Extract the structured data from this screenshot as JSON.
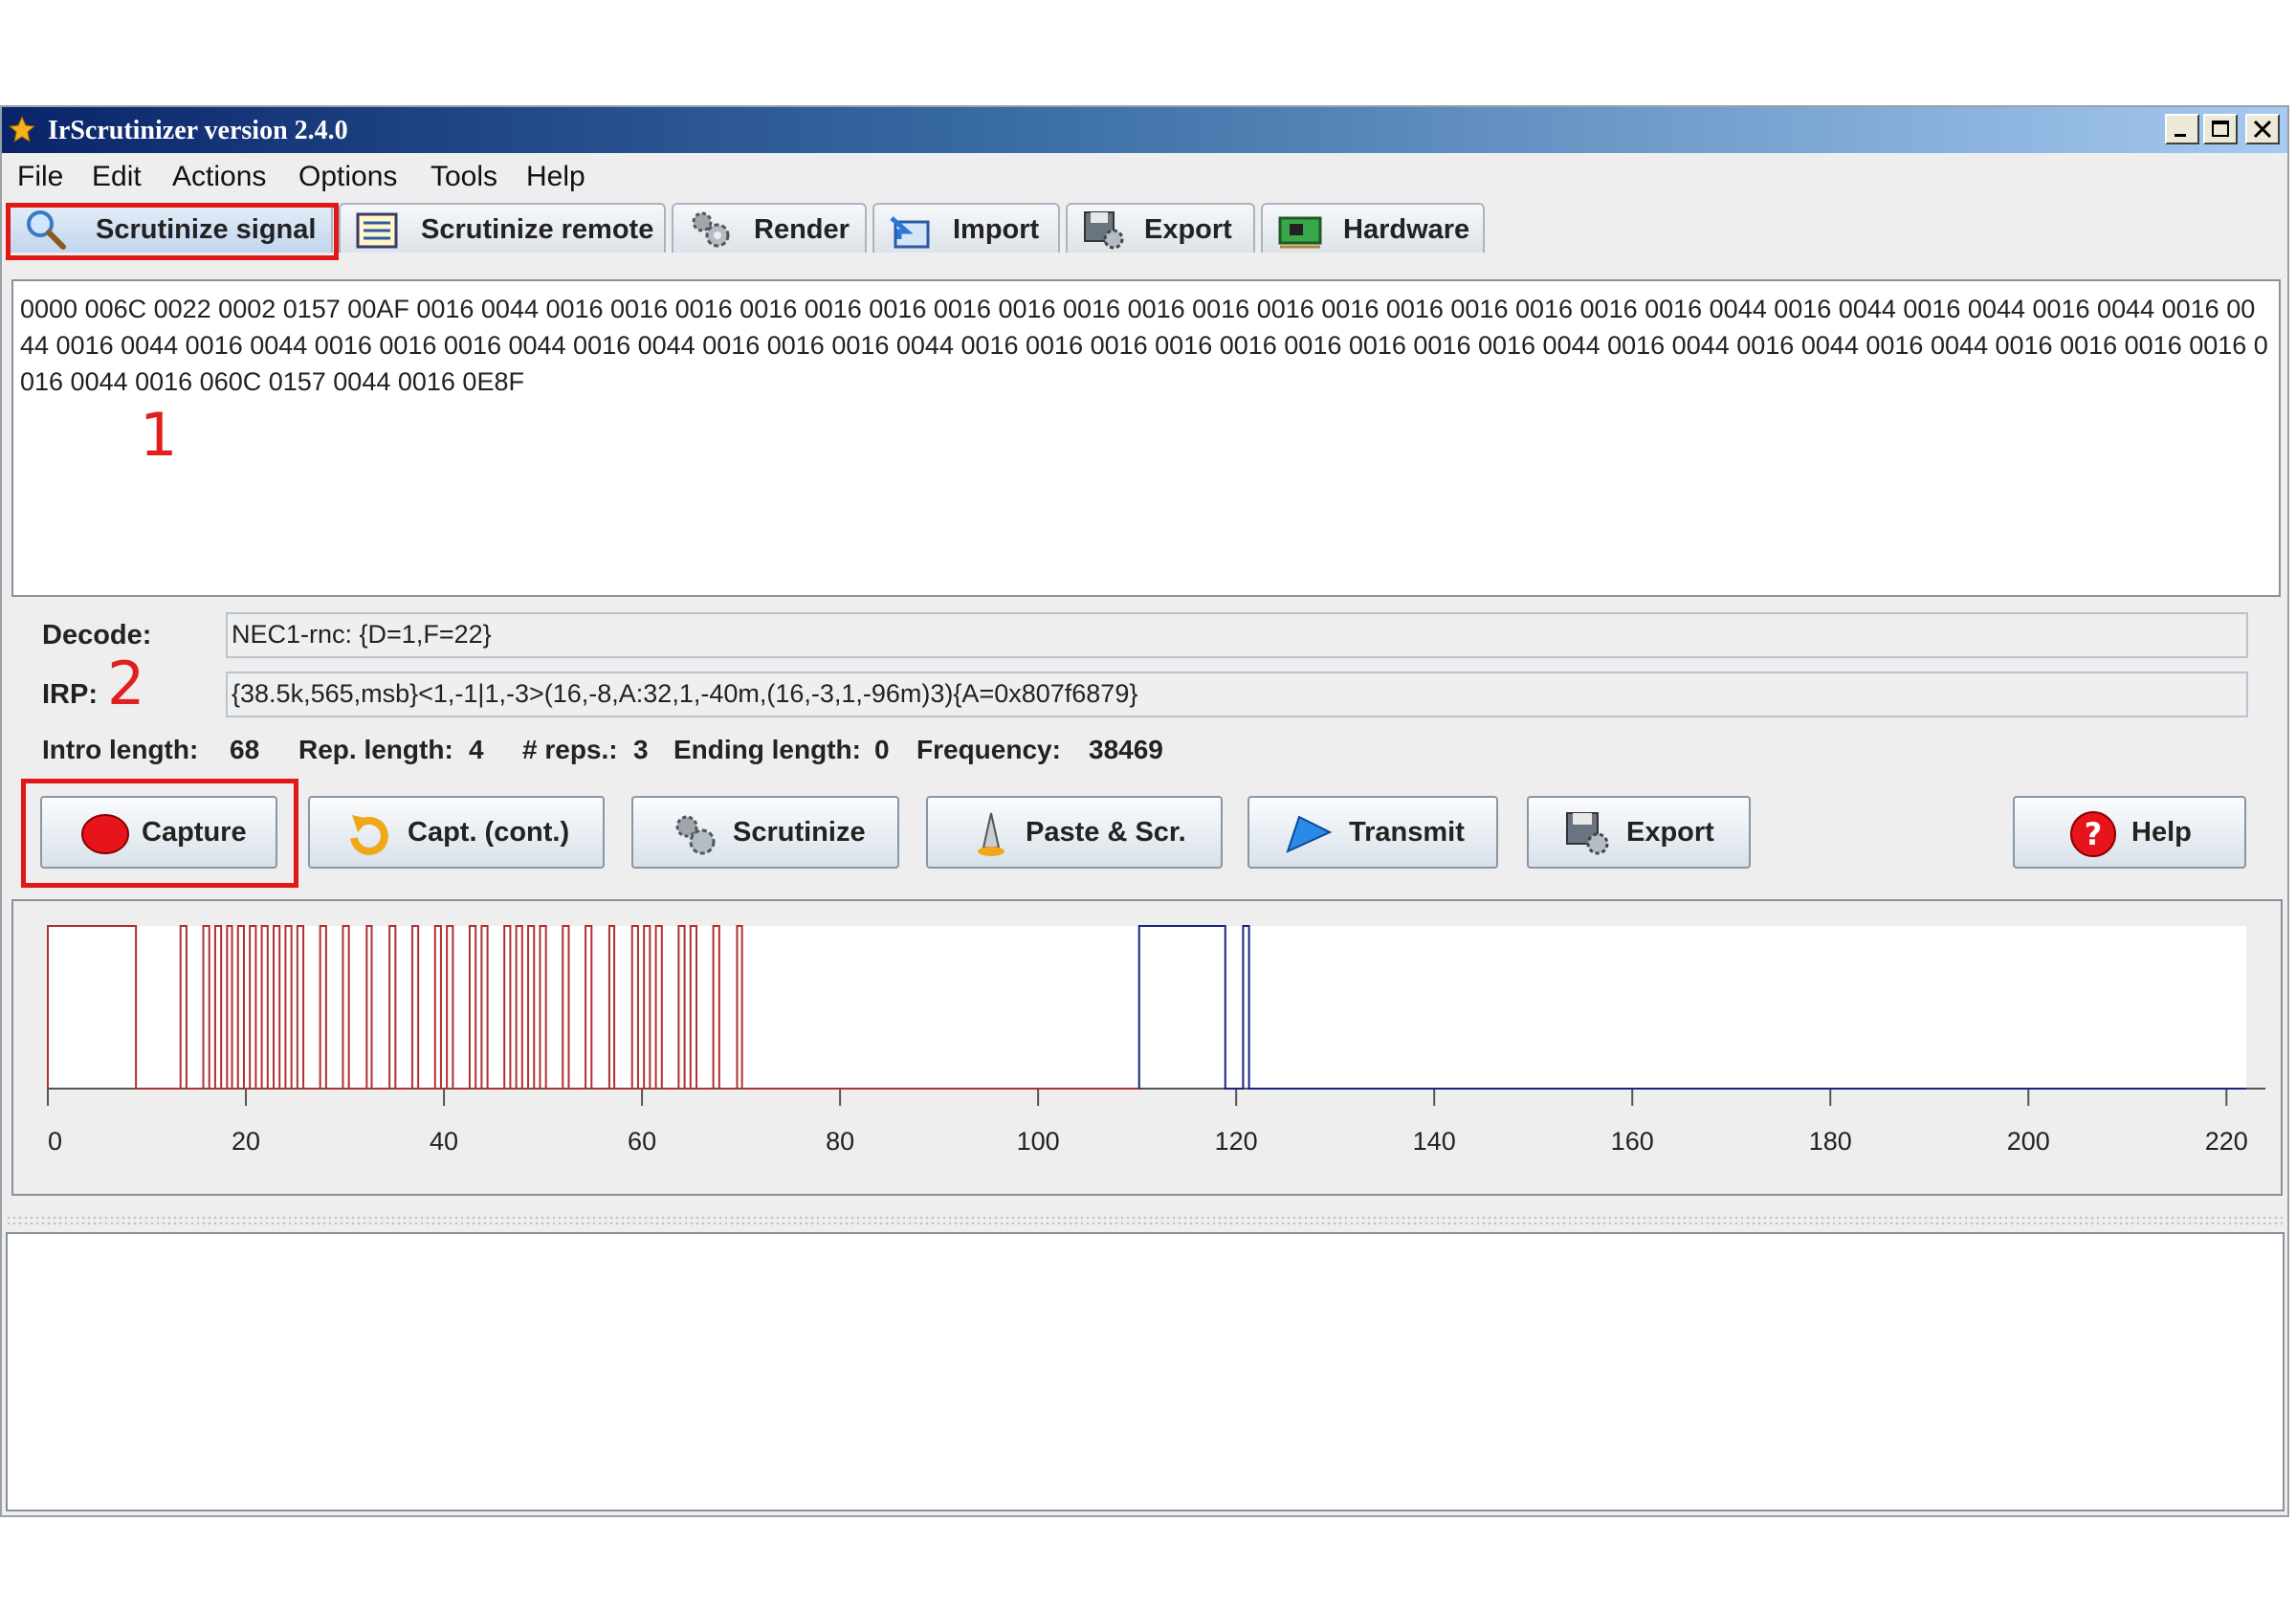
{
  "window": {
    "title": "IrScrutinizer version 2.4.0"
  },
  "menu": [
    "File",
    "Edit",
    "Actions",
    "Options",
    "Tools",
    "Help"
  ],
  "tabs": [
    {
      "label": "Scrutinize signal",
      "icon": "magnifier-icon",
      "active": true
    },
    {
      "label": "Scrutinize remote",
      "icon": "list-icon"
    },
    {
      "label": "Render",
      "icon": "gears-icon"
    },
    {
      "label": "Import",
      "icon": "import-icon"
    },
    {
      "label": "Export",
      "icon": "floppy-gear-icon"
    },
    {
      "label": "Hardware",
      "icon": "hardware-board-icon"
    }
  ],
  "signal": {
    "text": "0000 006C 0022 0002 0157 00AF 0016 0044 0016 0016 0016 0016 0016 0016 0016 0016 0016 0016 0016 0016 0016 0016 0016 0016 0016 0016 0044 0016 0044 0016 0044 0016 0044 0016 0044 0016 0044 0016 0044 0016 0016 0016 0044 0016 0044 0016 0016 0016 0044 0016 0016 0016 0016 0016 0016 0016 0016 0016 0044 0016 0044 0016 0044 0016 0044 0016 0016 0016 0016 0016 0044 0016 060C 0157 0044 0016 0E8F"
  },
  "annotations": {
    "one": "1",
    "two": "2"
  },
  "decode": {
    "label": "Decode:",
    "value": "NEC1-rnc: {D=1,F=22}"
  },
  "irp": {
    "label": "IRP:",
    "value": "{38.5k,565,msb}<1,-1|1,-3>(16,-8,A:32,1,-40m,(16,-3,1,-96m)3){A=0x807f6879}"
  },
  "stats": {
    "intro_label": "Intro length:",
    "intro_value": "68",
    "rep_label": "Rep. length:",
    "rep_value": "4",
    "reps_label": "# reps.:",
    "reps_value": "3",
    "ending_label": "Ending length:",
    "ending_value": "0",
    "freq_label": "Frequency:",
    "freq_value": "38469"
  },
  "buttons": {
    "capture": "Capture",
    "capture_cont": "Capt. (cont.)",
    "scrutinize": "Scrutinize",
    "paste": "Paste & Scr.",
    "transmit": "Transmit",
    "export": "Export",
    "help": "Help"
  },
  "colors": {
    "intro": "#b03030",
    "repeat": "#1a237e",
    "highlight": "#e01818"
  },
  "chart_data": {
    "type": "line",
    "title": "",
    "xlabel": "",
    "ylabel": "",
    "xlim": [
      0,
      222
    ],
    "x_ticks": [
      0,
      20,
      40,
      60,
      80,
      100,
      120,
      140,
      160,
      180,
      200,
      220
    ],
    "grid": false,
    "series": [
      {
        "color": "#b03030",
        "pulses": [
          [
            0,
            8.9
          ],
          [
            13.4,
            14.0
          ],
          [
            15.7,
            16.3
          ],
          [
            16.9,
            17.5
          ],
          [
            18.1,
            18.6
          ],
          [
            19.2,
            19.8
          ],
          [
            20.4,
            21.0
          ],
          [
            21.6,
            22.2
          ],
          [
            22.8,
            23.4
          ],
          [
            24.0,
            24.6
          ],
          [
            25.2,
            25.8
          ],
          [
            27.5,
            28.1
          ],
          [
            29.8,
            30.4
          ],
          [
            32.2,
            32.7
          ],
          [
            34.5,
            35.1
          ],
          [
            36.8,
            37.4
          ],
          [
            39.1,
            39.7
          ],
          [
            40.3,
            40.9
          ],
          [
            42.6,
            43.2
          ],
          [
            43.8,
            44.4
          ],
          [
            46.1,
            46.7
          ],
          [
            47.3,
            47.9
          ],
          [
            48.5,
            49.1
          ],
          [
            49.7,
            50.3
          ],
          [
            52.0,
            52.6
          ],
          [
            54.3,
            54.9
          ],
          [
            56.7,
            57.2
          ],
          [
            59.0,
            59.6
          ],
          [
            60.2,
            60.8
          ],
          [
            61.4,
            62.0
          ],
          [
            63.7,
            64.3
          ],
          [
            64.9,
            65.5
          ],
          [
            67.2,
            67.8
          ],
          [
            69.6,
            70.1
          ]
        ]
      },
      {
        "color": "#1a237e",
        "pulses": [
          [
            110.2,
            118.9
          ],
          [
            120.7,
            121.3
          ]
        ]
      }
    ]
  }
}
